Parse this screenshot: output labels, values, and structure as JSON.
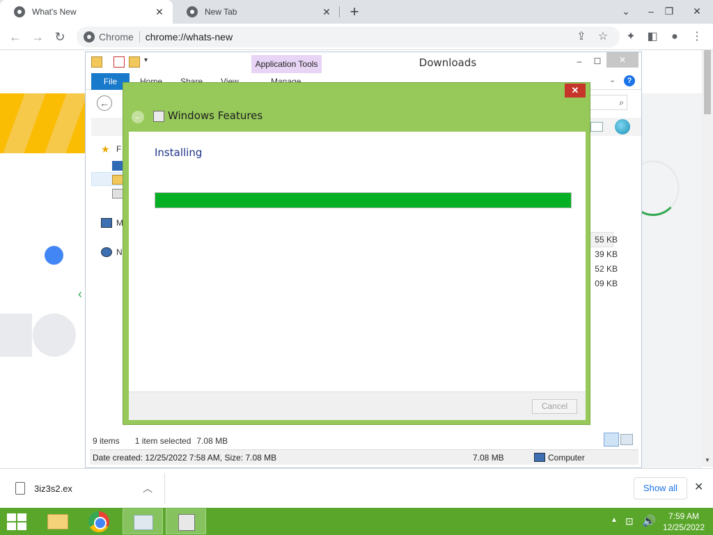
{
  "browser": {
    "tabs": [
      {
        "label": "What's New",
        "active": true
      },
      {
        "label": "New Tab",
        "active": false
      }
    ],
    "omnibox": {
      "chip": "Chrome",
      "url": "chrome://whats-new"
    }
  },
  "explorer": {
    "title": "Downloads",
    "contextual_tab": "Application Tools",
    "ribbon_tabs": [
      "File",
      "Home",
      "Share",
      "View",
      "Manage"
    ],
    "nav_items": [
      {
        "label": "F",
        "icon": "star-icon"
      },
      {
        "label": "",
        "icon": "desktop-icon"
      },
      {
        "label": "",
        "icon": "downloads-folder-icon"
      },
      {
        "label": "",
        "icon": "recent-places-icon"
      },
      {
        "label": "M",
        "icon": "computer-icon"
      },
      {
        "label": "N",
        "icon": "network-icon"
      }
    ],
    "sizes": [
      "55 KB",
      "39 KB",
      "52 KB",
      "09 KB"
    ],
    "status": {
      "item_count": "9 items",
      "selection": "1 item selected",
      "selection_size": "7.08 MB"
    },
    "details": {
      "created": "Date created: 12/25/2022 7:58 AM, Size: 7.08 MB",
      "size": "7.08 MB",
      "location": "Computer"
    }
  },
  "dialog": {
    "title": "Windows Features",
    "heading": "Installing",
    "progress": 1.0,
    "cancel_label": "Cancel",
    "close_label": "✕"
  },
  "download_bar": {
    "filename": "3iz3s2.ex",
    "show_all": "Show all"
  },
  "taskbar": {
    "clock_time": "7:59 AM",
    "clock_date": "12/25/2022"
  },
  "colors": {
    "dialog_frame": "#96c95a",
    "progress_fill": "#06b025",
    "taskbar": "#5aa62b",
    "file_tab": "#1979ca"
  }
}
